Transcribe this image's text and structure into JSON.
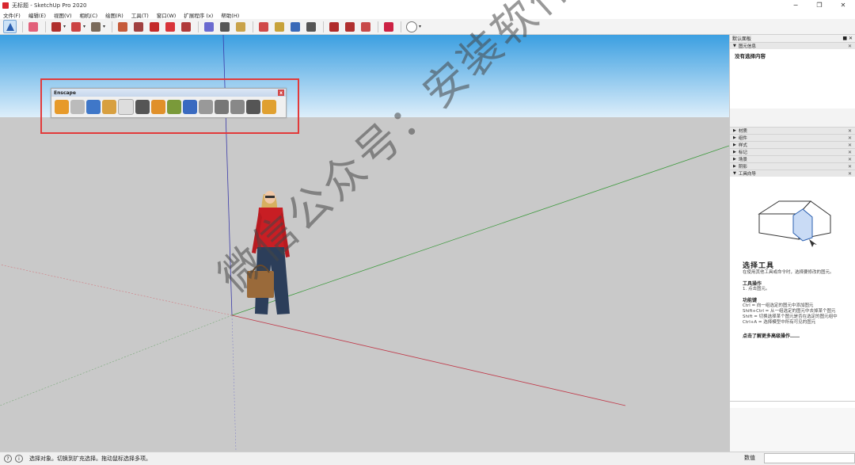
{
  "window": {
    "title": "无标题 - SketchUp Pro 2020",
    "controls": [
      "−",
      "❐",
      "✕"
    ]
  },
  "menu": [
    "文件(F)",
    "编辑(E)",
    "视图(V)",
    "相机(C)",
    "绘图(R)",
    "工具(T)",
    "窗口(W)",
    "扩展程序 (x)",
    "帮助(H)"
  ],
  "toolbar_icons": [
    "select-icon",
    "eraser-icon",
    "line-icon",
    "arc-icon",
    "shape-icon",
    "pushpull-icon",
    "followme-icon",
    "move-icon",
    "rotate-icon",
    "scale-icon",
    "tape-icon",
    "text-icon",
    "paint-icon",
    "orbit-icon",
    "pan-icon",
    "zoom-icon",
    "zoom-extents-icon",
    "warehouse-icon",
    "extension-icon",
    "share-icon",
    "ruby-icon",
    "profile-icon"
  ],
  "toolbar_colors": [
    "#2a5fb0",
    "#e2607a",
    "#b0302e",
    "#c44",
    "#7a6a5a",
    "#c55a3a",
    "#a04040",
    "#c42a2a",
    "#d8343a",
    "#b03a3a",
    "#6b6bd0",
    "#555",
    "#c9a34a",
    "#d04a4a",
    "#c7a23a",
    "#3a6ab8",
    "#555",
    "#b02a2a",
    "#b03030",
    "#c84a4a",
    "#cc2244",
    "#888"
  ],
  "enscape": {
    "title": "Enscape",
    "close": "x",
    "icons": [
      "enscape-start-icon",
      "refresh-icon",
      "live-update-icon",
      "sync-views-icon",
      "screenshot-icon",
      "video-icon",
      "asset-icon",
      "vegetation-icon",
      "settings-icon",
      "sound-icon",
      "batch-icon",
      "panorama-icon",
      "feedback-icon",
      "about-icon"
    ],
    "icon_colors": [
      "#e79a2a",
      "#bbb",
      "#3f77c8",
      "#d8a040",
      "#ddd",
      "#555",
      "#e0902a",
      "#7a9a3a",
      "#3a6ac0",
      "#999",
      "#777",
      "#888",
      "#555",
      "#e0a030"
    ]
  },
  "right_panel": {
    "tray_title": "默认面板",
    "entity_info": "图元信息",
    "no_selection": "没有选择内容",
    "sections": [
      "材质",
      "组件",
      "样式",
      "标记",
      "场景",
      "阴影"
    ],
    "instructor": "工具向导",
    "guide": {
      "title": "选择工具",
      "desc": "在使用其他工具或命令时，选择要修改的图元。",
      "ops_head": "工具操作",
      "ops": "1. 点击图元。",
      "keys_head": "功能键",
      "keys": [
        "Ctrl = 向一组选定的图元中添加图元",
        "Shift+Ctrl = 从一组选定的图元中去掉某个图元",
        "Shift = 切换选择某个图元是否在选定的图元组中",
        "Ctrl+A = 选择模型中所有可见的图元"
      ],
      "more": "点击了解更多高级操作……"
    }
  },
  "status": {
    "icon_a": "?",
    "icon_b": "i",
    "message": "选择对象。切换到扩充选择。拖动鼠标选择多项。",
    "measure_label": "数值"
  },
  "watermark": {
    "text": "微信公众号：安装软件指南"
  },
  "colors": {
    "sky_top": "#3b9fe1",
    "sky_bottom": "#ddeefa",
    "ground": "#c9c9c9"
  }
}
